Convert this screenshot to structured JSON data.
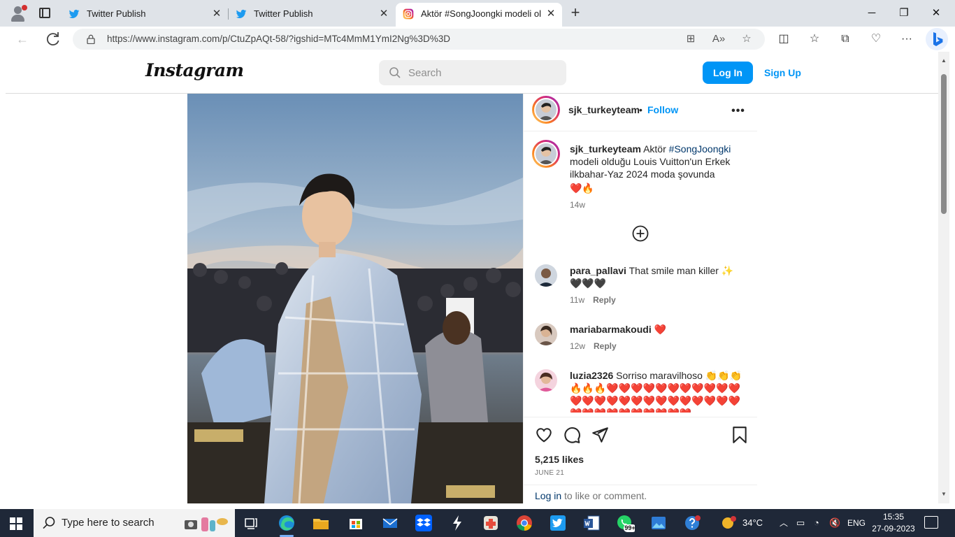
{
  "browser": {
    "tabs": [
      {
        "title": "Twitter Publish",
        "icon": "twitter-icon",
        "active": false
      },
      {
        "title": "Twitter Publish",
        "icon": "twitter-icon",
        "active": false
      },
      {
        "title": "Aktör #SongJoongki modeli oldu",
        "icon": "instagram-icon",
        "active": true
      }
    ],
    "new_tab": "+",
    "close_glyph": "✕",
    "url": "https://www.instagram.com/p/CtuZpAQt-58/?igshid=MTc4MmM1YmI2Ng%3D%3D",
    "window_controls": {
      "minimize": "─",
      "restore": "❐",
      "close": "✕"
    }
  },
  "instagram": {
    "logo": "Instagram",
    "search_placeholder": "Search",
    "login_label": "Log In",
    "signup_label": "Sign Up",
    "post": {
      "author": "sjk_turkeyteam",
      "separator": "•",
      "follow_label": "Follow",
      "more": "•••",
      "caption": {
        "user": "sjk_turkeyteam",
        "text_before": "Aktör",
        "hashtag": "#SongJoongki",
        "text_after": "modeli olduğu Louis Vuitton'un Erkek ilkbahar-Yaz 2024 moda şovunda",
        "emoji": "❤️🔥",
        "time": "14w"
      },
      "comments": [
        {
          "user": "para_pallavi",
          "text": "That smile man killer ✨🖤🖤🖤",
          "time": "11w",
          "reply": "Reply"
        },
        {
          "user": "mariabarmakoudi",
          "text": "❤️",
          "time": "12w",
          "reply": "Reply"
        },
        {
          "user": "luzia2326",
          "text": "Sorriso maravilhoso 👏👏👏🔥🔥🔥❤️❤️❤️❤️❤️❤️❤️❤️❤️❤️❤️❤️❤️❤️❤️❤️❤️❤️❤️❤️❤️❤️❤️❤️❤️❤️❤️❤️❤️❤️❤️❤️❤️❤️❤️",
          "time": "",
          "reply": ""
        }
      ],
      "likes": "5,215 likes",
      "date": "JUNE 21",
      "login_link": "Log in",
      "login_rest": " to like or comment."
    }
  },
  "taskbar": {
    "search_placeholder": "Type here to search",
    "weather": "34°C",
    "language": "ENG",
    "time": "15:35",
    "date": "27-09-2023",
    "whatsapp_badge": "99+"
  },
  "colors": {
    "accent": "#0095f6",
    "taskbar": "#1f2838",
    "tabstrip": "#dfe3e8"
  }
}
